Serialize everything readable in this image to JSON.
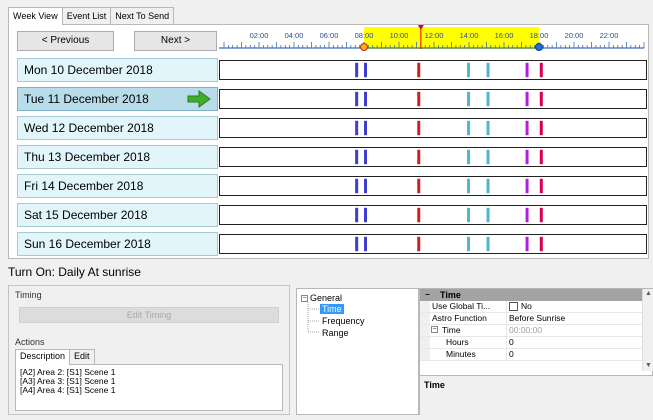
{
  "tabs": [
    "Week View",
    "Event List",
    "Next To Send"
  ],
  "nav": {
    "prev_label": "< Previous",
    "next_label": "Next >"
  },
  "ruler": {
    "labels": [
      "02:00",
      "04:00",
      "06:00",
      "08:00",
      "10:00",
      "12:00",
      "14:00",
      "16:00",
      "18:00",
      "20:00",
      "22:00"
    ],
    "daylight_start_hour": 8,
    "daylight_end_hour": 18,
    "current_time_hour": 11.25,
    "highlight_color": "#ffff00",
    "current_marker_color": "#e0001b"
  },
  "days": [
    {
      "label": "Mon 10 December 2018",
      "selected": false
    },
    {
      "label": "Tue 11 December 2018",
      "selected": true
    },
    {
      "label": "Wed 12 December 2018",
      "selected": false
    },
    {
      "label": "Thu 13 December 2018",
      "selected": false
    },
    {
      "label": "Fri 14 December 2018",
      "selected": false
    },
    {
      "label": "Sat 15 December 2018",
      "selected": false
    },
    {
      "label": "Sun 16 December 2018",
      "selected": false
    }
  ],
  "events": [
    {
      "hour": 7.7,
      "color": "#3c3ccf"
    },
    {
      "hour": 8.2,
      "color": "#3c3ccf"
    },
    {
      "hour": 11.2,
      "color": "#d61b1b"
    },
    {
      "hour": 14.0,
      "color": "#4fb6d0"
    },
    {
      "hour": 15.1,
      "color": "#4fb6d0"
    },
    {
      "hour": 17.3,
      "color": "#b21ee0"
    },
    {
      "hour": 18.1,
      "color": "#d6004e"
    }
  ],
  "status_text": "Turn On: Daily At sunrise",
  "left_pane": {
    "timing_label": "Timing",
    "edit_timing_label": "Edit Timing",
    "actions_label": "Actions",
    "subtabs": [
      "Description",
      "Edit"
    ],
    "description_lines": [
      "[A2] Area 2: [S1] Scene 1",
      "[A3] Area 3: [S1] Scene 1",
      "[A4] Area 4: [S1] Scene 1"
    ]
  },
  "tree": {
    "root": "General",
    "children": [
      "Time",
      "Frequency",
      "Range"
    ],
    "selected": "Time"
  },
  "properties": {
    "header": "Time",
    "rows": [
      {
        "name": "Use Global Ti...",
        "value": "No",
        "checkbox": true
      },
      {
        "name": "Astro Function",
        "value": "Before Sunrise"
      },
      {
        "name": "Time",
        "value": "00:00:00",
        "expandable": true,
        "muted": true
      },
      {
        "name": "Hours",
        "value": "0",
        "indent": true
      },
      {
        "name": "Minutes",
        "value": "0",
        "indent": true
      }
    ],
    "description_title": "Time"
  }
}
